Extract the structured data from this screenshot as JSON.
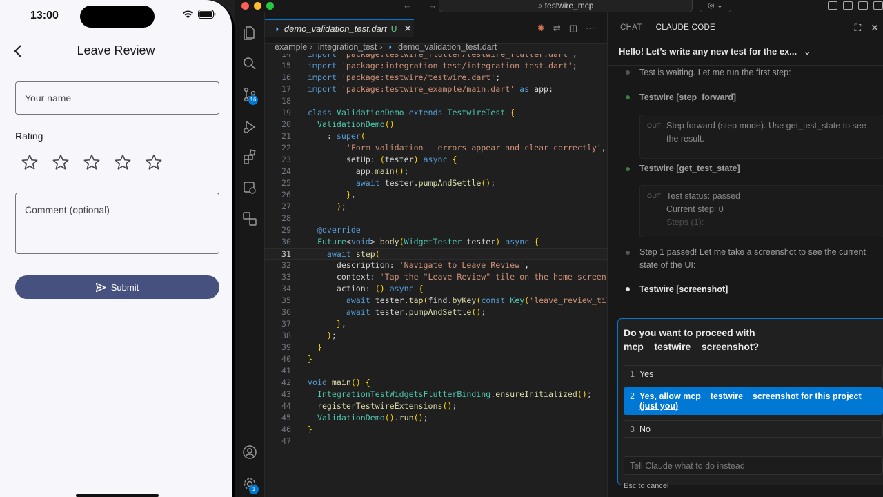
{
  "phone": {
    "time": "13:00",
    "screen_title": "Leave Review",
    "name_placeholder": "Your name",
    "rating_label": "Rating",
    "stars_filled": 0,
    "stars_total": 5,
    "comment_placeholder": "Comment (optional)",
    "submit_label": "Submit",
    "colors": {
      "primary": "#46517f",
      "background": "#f7f6fb"
    }
  },
  "window": {
    "search": "testwire_mcp",
    "nav_arrows": "← →"
  },
  "editor": {
    "tab_label": "demo_validation_test.dart",
    "tab_modified": "U",
    "breadcrumb": [
      "example",
      "integration_test",
      "demo_validation_test.dart"
    ],
    "current_line": 31,
    "lines": [
      {
        "n": "14",
        "text": "import 'package:testwire_flutter/testwire_flutter.dart';"
      },
      {
        "n": "15",
        "text": "import 'package:integration_test/integration_test.dart';"
      },
      {
        "n": "16",
        "text": "import 'package:testwire/testwire.dart';"
      },
      {
        "n": "17",
        "text": "import 'package:testwire_example/main.dart' as app;"
      },
      {
        "n": "18",
        "text": ""
      },
      {
        "n": "19",
        "text": "class ValidationDemo extends TestwireTest {"
      },
      {
        "n": "20",
        "text": "  ValidationDemo()"
      },
      {
        "n": "21",
        "text": "    : super("
      },
      {
        "n": "22",
        "text": "        'Form validation — errors appear and clear correctly',"
      },
      {
        "n": "23",
        "text": "        setUp: (tester) async {"
      },
      {
        "n": "24",
        "text": "          app.main();"
      },
      {
        "n": "25",
        "text": "          await tester.pumpAndSettle();"
      },
      {
        "n": "26",
        "text": "        },"
      },
      {
        "n": "27",
        "text": "      );"
      },
      {
        "n": "28",
        "text": ""
      },
      {
        "n": "29",
        "text": "  @override"
      },
      {
        "n": "30",
        "text": "  Future<void> body(WidgetTester tester) async {"
      },
      {
        "n": "31",
        "text": "    await step("
      },
      {
        "n": "32",
        "text": "      description: 'Navigate to Leave Review',"
      },
      {
        "n": "33",
        "text": "      context: 'Tap the \"Leave Review\" tile on the home screen.'"
      },
      {
        "n": "34",
        "text": "      action: () async {"
      },
      {
        "n": "35",
        "text": "        await tester.tap(find.byKey(const Key('leave_review_tile"
      },
      {
        "n": "36",
        "text": "        await tester.pumpAndSettle();"
      },
      {
        "n": "37",
        "text": "      },"
      },
      {
        "n": "38",
        "text": "    );"
      },
      {
        "n": "39",
        "text": "  }"
      },
      {
        "n": "40",
        "text": "}"
      },
      {
        "n": "41",
        "text": ""
      },
      {
        "n": "42",
        "text": "void main() {"
      },
      {
        "n": "43",
        "text": "  IntegrationTestWidgetsFlutterBinding.ensureInitialized();"
      },
      {
        "n": "44",
        "text": "  registerTestwireExtensions();"
      },
      {
        "n": "45",
        "text": "  ValidationDemo().run();"
      },
      {
        "n": "46",
        "text": "}"
      },
      {
        "n": "47",
        "text": ""
      }
    ]
  },
  "activity": {
    "scm_badge": "16",
    "settings_badge": "1"
  },
  "panel": {
    "tabs": [
      "CHAT",
      "CLAUDE CODE"
    ],
    "active_tab": "CLAUDE CODE",
    "session_title": "Hello! Let’s write any new test for the ex...",
    "messages": [
      {
        "kind": "text",
        "text": "Test is waiting. Let me run the first step:"
      },
      {
        "kind": "tool",
        "name": "Testwire [step_forward]"
      },
      {
        "kind": "out",
        "label": "OUT",
        "text": "Step forward (step mode). Use get_test_state to see the result."
      },
      {
        "kind": "tool",
        "name": "Testwire [get_test_state]"
      },
      {
        "kind": "out",
        "label": "OUT",
        "lines": [
          "Test status: passed",
          "Current step: 0",
          "Steps (1):"
        ]
      },
      {
        "kind": "text",
        "text": "Step 1 passed! Let me take a screenshot to see the current state of the UI:"
      },
      {
        "kind": "tool",
        "name": "Testwire [screenshot]"
      }
    ],
    "prompt": {
      "question": "Do you want to proceed with mcp__testwire__screenshot?",
      "options": [
        {
          "num": "1",
          "label": "Yes"
        },
        {
          "num": "2",
          "label": "Yes, allow mcp__testwire__screenshot for ",
          "link": "this project (just you)"
        },
        {
          "num": "3",
          "label": "No"
        }
      ],
      "selected": 2,
      "input_placeholder": "Tell Claude what to do instead",
      "esc_hint": "Esc to cancel"
    },
    "colors": {
      "accent": "#0078d4"
    }
  }
}
